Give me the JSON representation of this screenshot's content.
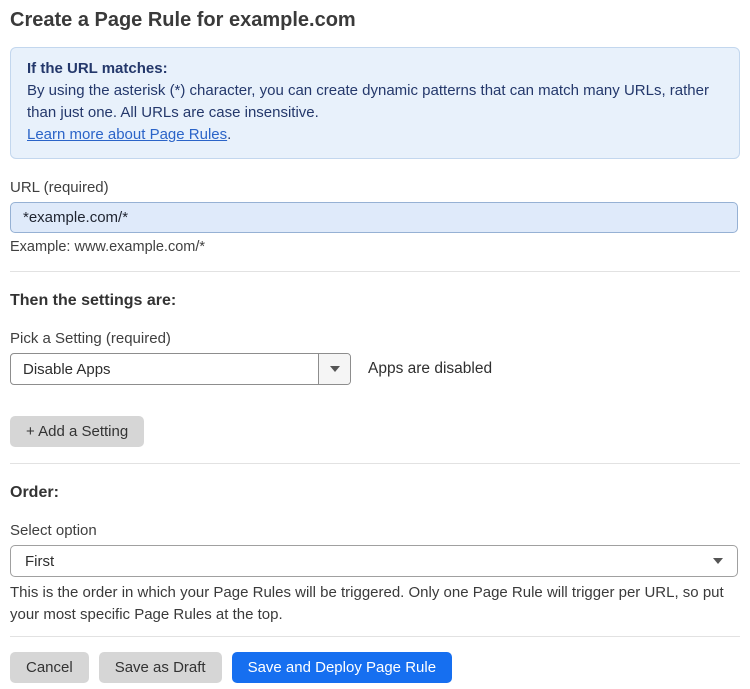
{
  "page": {
    "title": "Create a Page Rule for example.com"
  },
  "info_box": {
    "heading": "If the URL matches:",
    "body": "By using the asterisk (*) character, you can create dynamic patterns that can match many URLs, rather than just one. All URLs are case insensitive.",
    "link_label": "Learn more about Page Rules",
    "link_suffix": "."
  },
  "url_field": {
    "label": "URL (required)",
    "value": "*example.com/*",
    "helper": "Example: www.example.com/*"
  },
  "settings_section": {
    "heading": "Then the settings are:",
    "setting_label": "Pick a Setting (required)",
    "setting_value": "Disable Apps",
    "setting_status": "Apps are disabled",
    "add_setting_label": "+ Add a Setting"
  },
  "order_section": {
    "heading": "Order:",
    "label": "Select option",
    "value": "First",
    "helper": "This is the order in which your Page Rules will be triggered. Only one Page Rule will trigger per URL, so put your most specific Page Rules at the top."
  },
  "footer": {
    "cancel_label": "Cancel",
    "save_draft_label": "Save as Draft",
    "save_deploy_label": "Save and Deploy Page Rule"
  },
  "colors": {
    "accent_blue": "#166ff0",
    "info_box_bg": "#e8f1fb",
    "info_box_border": "#c3d7ee",
    "info_text_navy": "#24386b",
    "link_blue": "#2b64c8",
    "url_input_bg": "#dfeafa",
    "url_input_border": "#96b1d4",
    "gray_button_bg": "#d6d6d6"
  }
}
